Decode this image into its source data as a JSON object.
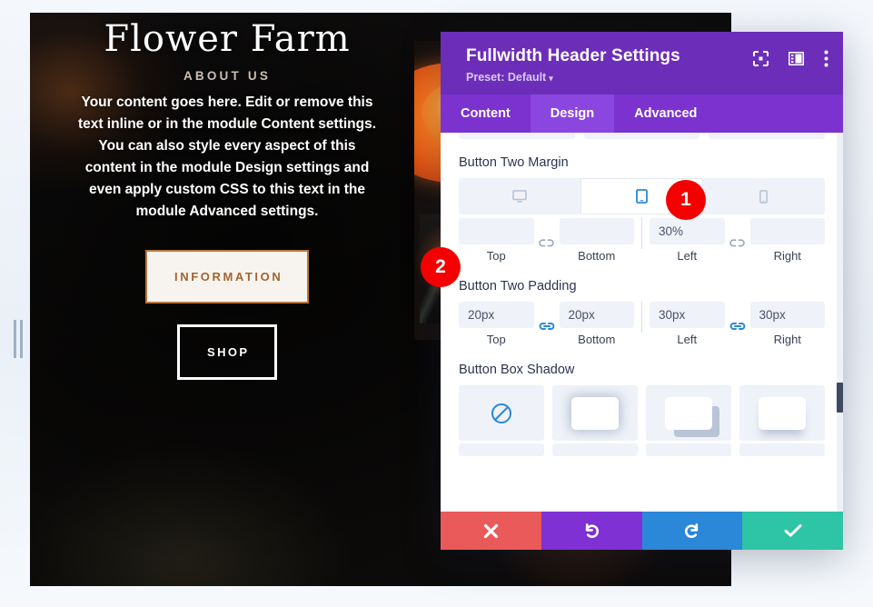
{
  "website": {
    "title": "Flower Farm",
    "eyebrow": "ABOUT US",
    "body": "Your content goes here. Edit or remove this text inline or in the module Content settings. You can also style every aspect of this content in the module Design settings and even apply custom CSS to this text in the module Advanced settings.",
    "button_one": "INFORMATION",
    "button_two": "SHOP"
  },
  "panel": {
    "title": "Fullwidth Header Settings",
    "preset": "Preset: Default",
    "preset_caret": "▾",
    "header_icons": [
      {
        "name": "fullscreen-icon",
        "label": "Expand"
      },
      {
        "name": "layout-view-icon",
        "label": "Change view"
      },
      {
        "name": "more-options-icon",
        "label": "More options"
      }
    ],
    "tabs": [
      {
        "label": "Content",
        "active": false
      },
      {
        "label": "Design",
        "active": true
      },
      {
        "label": "Advanced",
        "active": false
      }
    ],
    "device_toggle": {
      "options": [
        {
          "name": "desktop",
          "active": false
        },
        {
          "name": "tablet",
          "active": true
        },
        {
          "name": "phone",
          "active": false
        }
      ]
    },
    "sections": {
      "button_two_margin": {
        "label": "Button Two Margin",
        "linked_top_bottom": false,
        "linked_left_right": false,
        "fields": [
          {
            "label": "Top",
            "value": "",
            "placeholder": ""
          },
          {
            "label": "Bottom",
            "value": "",
            "placeholder": ""
          },
          {
            "label": "Left",
            "value": "30%",
            "placeholder": ""
          },
          {
            "label": "Right",
            "value": "",
            "placeholder": ""
          }
        ]
      },
      "button_two_padding": {
        "label": "Button Two Padding",
        "linked_top_bottom": true,
        "linked_left_right": true,
        "fields": [
          {
            "label": "Top",
            "value": "20px",
            "placeholder": ""
          },
          {
            "label": "Bottom",
            "value": "20px",
            "placeholder": ""
          },
          {
            "label": "Left",
            "value": "30px",
            "placeholder": ""
          },
          {
            "label": "Right",
            "value": "30px",
            "placeholder": ""
          }
        ]
      },
      "button_box_shadow": {
        "label": "Button Box Shadow",
        "options": [
          {
            "name": "none",
            "selected": true
          },
          {
            "name": "outer-glow",
            "selected": false
          },
          {
            "name": "offset-down-right",
            "selected": false
          },
          {
            "name": "drop-bottom",
            "selected": false
          }
        ]
      }
    },
    "actions": [
      {
        "name": "cancel",
        "glyph": "✖",
        "color": "#eb5a5a"
      },
      {
        "name": "undo",
        "glyph": "↺",
        "color": "#7f31d4"
      },
      {
        "name": "redo",
        "glyph": "↻",
        "color": "#2b87d8"
      },
      {
        "name": "save",
        "glyph": "✔",
        "color": "#2ec4a6"
      }
    ]
  },
  "annotations": [
    {
      "number": "1",
      "color": "#f40000"
    },
    {
      "number": "2",
      "color": "#f40000"
    }
  ],
  "colors": {
    "panel_header": "#6c2eb9",
    "tab_bar": "#7b32cf",
    "tab_active": "#8c46e0",
    "accent_blue": "#2b87d8",
    "field_bg": "#eff2f8",
    "badge_red": "#f40000"
  }
}
